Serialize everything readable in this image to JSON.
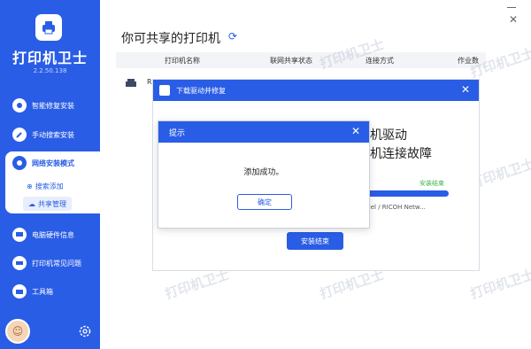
{
  "app": {
    "title": "打印机卫士",
    "version": "2.2.50.138"
  },
  "sidebar": {
    "items": [
      {
        "label": "智能修复安装"
      },
      {
        "label": "手动搜索安装"
      },
      {
        "label": "网络安装模式"
      },
      {
        "label": "电脑硬件信息"
      },
      {
        "label": "打印机常见问题"
      },
      {
        "label": "工具箱"
      }
    ],
    "sub_items": [
      {
        "label": "搜索添加"
      },
      {
        "label": "共享管理"
      }
    ]
  },
  "main": {
    "page_title": "你可共享的打印机",
    "table_headers": [
      "打印机名称",
      "联网共享状态",
      "连接方式",
      "作业数"
    ],
    "row_fragment": "R"
  },
  "watermark": "打印机卫士",
  "dialog_install": {
    "title": "下载驱动并修复",
    "text_line1": "机驱动",
    "text_line2": "机连接故障",
    "progress_label": "安装结束",
    "progress_fraction": 1.0,
    "model_text": "odel / RICOH Netw...",
    "finish_label": "安装结束"
  },
  "dialog_tip": {
    "title": "提示",
    "message": "添加成功。",
    "ok_label": "确定"
  },
  "colors": {
    "accent": "#2a5de6",
    "success": "#3fb34f"
  }
}
